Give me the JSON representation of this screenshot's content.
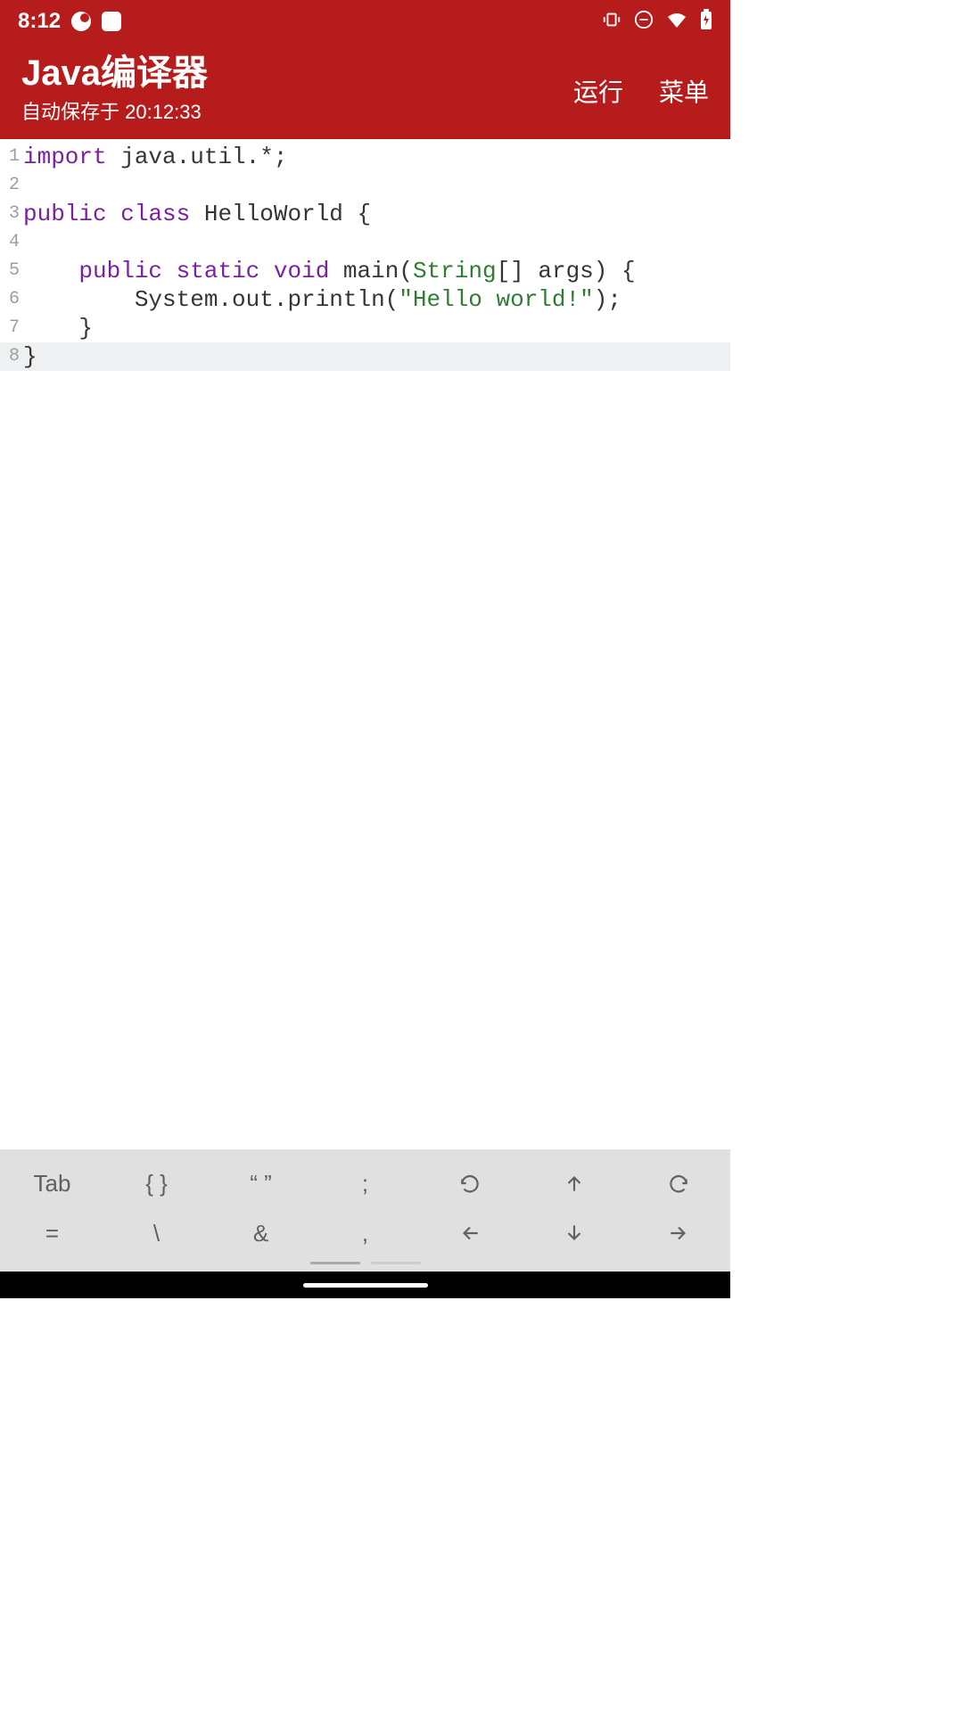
{
  "status": {
    "time": "8:12"
  },
  "appbar": {
    "title": "Java编译器",
    "subtitle": "自动保存于 20:12:33",
    "run_label": "运行",
    "menu_label": "菜单"
  },
  "code": {
    "lines": [
      {
        "num": "1"
      },
      {
        "num": "2"
      },
      {
        "num": "3"
      },
      {
        "num": "4"
      },
      {
        "num": "5"
      },
      {
        "num": "6"
      },
      {
        "num": "7"
      },
      {
        "num": "8"
      }
    ],
    "kw_import": "import",
    "l1_rest": " java.util.*;",
    "kw_public": "public",
    "kw_class": "class",
    "l3_rest": " HelloWorld {",
    "l5_indent": "    ",
    "kw_static": "static",
    "kw_void": "void",
    "l5_main": " main(",
    "type_string": "String",
    "l5_args": "[] args) {",
    "l6_indent": "        ",
    "l6_call": "System.out.println(",
    "str_hello": "\"Hello world!\"",
    "l6_end": ");",
    "l7": "    }",
    "l8": "}"
  },
  "toolbar": {
    "row1": {
      "tab": "Tab",
      "braces": "{ }",
      "quotes": "“ ”",
      "semicolon": ";"
    },
    "row2": {
      "equals": "=",
      "backslash": "\\",
      "ampersand": "&",
      "comma": ","
    }
  }
}
